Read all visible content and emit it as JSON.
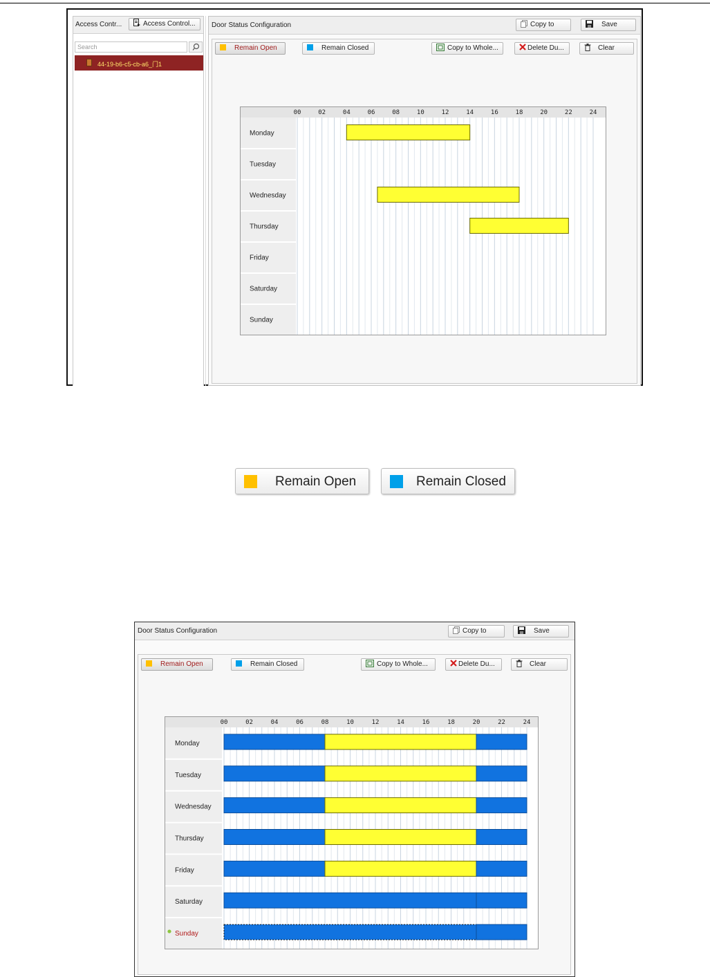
{
  "screen1": {
    "left_panel": {
      "title": "Access Contr...",
      "button": "Access Control...",
      "search_placeholder": "Search",
      "device": "44-19-b6-c5-cb-a6_门1"
    },
    "panel": {
      "title": "Door Status Configuration",
      "copy_to": "Copy to",
      "save": "Save",
      "remain_open": "Remain Open",
      "remain_closed": "Remain Closed",
      "copy_whole": "Copy to Whole...",
      "delete_duration": "Delete Du...",
      "clear": "Clear"
    },
    "schedule": {
      "hours": [
        "00",
        "02",
        "04",
        "06",
        "08",
        "10",
        "12",
        "14",
        "16",
        "18",
        "20",
        "22",
        "24"
      ],
      "days": [
        "Monday",
        "Tuesday",
        "Wednesday",
        "Thursday",
        "Friday",
        "Saturday",
        "Sunday"
      ],
      "segments": [
        {
          "day": 0,
          "start": 4,
          "end": 14,
          "mode": "open"
        },
        {
          "day": 2,
          "start": 6.5,
          "end": 18,
          "mode": "open"
        },
        {
          "day": 3,
          "start": 14,
          "end": 22,
          "mode": "open"
        }
      ]
    }
  },
  "legend": {
    "remain_open": "Remain Open",
    "remain_closed": "Remain Closed"
  },
  "screen2": {
    "panel": {
      "title": "Door Status Configuration",
      "copy_to": "Copy to",
      "save": "Save",
      "remain_open": "Remain Open",
      "remain_closed": "Remain Closed",
      "copy_whole": "Copy to Whole...",
      "delete_duration": "Delete Du...",
      "clear": "Clear"
    },
    "schedule": {
      "hours": [
        "00",
        "02",
        "04",
        "06",
        "08",
        "10",
        "12",
        "14",
        "16",
        "18",
        "20",
        "22",
        "24"
      ],
      "days": [
        "Monday",
        "Tuesday",
        "Wednesday",
        "Thursday",
        "Friday",
        "Saturday",
        "Sunday"
      ],
      "selected_day": 6,
      "segments": [
        {
          "day": 0,
          "start": 0,
          "end": 8,
          "mode": "closed"
        },
        {
          "day": 0,
          "start": 8,
          "end": 20,
          "mode": "open"
        },
        {
          "day": 0,
          "start": 20,
          "end": 24,
          "mode": "closed"
        },
        {
          "day": 1,
          "start": 0,
          "end": 8,
          "mode": "closed"
        },
        {
          "day": 1,
          "start": 8,
          "end": 20,
          "mode": "open"
        },
        {
          "day": 1,
          "start": 20,
          "end": 24,
          "mode": "closed"
        },
        {
          "day": 2,
          "start": 0,
          "end": 8,
          "mode": "closed"
        },
        {
          "day": 2,
          "start": 8,
          "end": 20,
          "mode": "open"
        },
        {
          "day": 2,
          "start": 20,
          "end": 24,
          "mode": "closed"
        },
        {
          "day": 3,
          "start": 0,
          "end": 8,
          "mode": "closed"
        },
        {
          "day": 3,
          "start": 8,
          "end": 20,
          "mode": "open"
        },
        {
          "day": 3,
          "start": 20,
          "end": 24,
          "mode": "closed"
        },
        {
          "day": 4,
          "start": 0,
          "end": 8,
          "mode": "closed"
        },
        {
          "day": 4,
          "start": 8,
          "end": 20,
          "mode": "open"
        },
        {
          "day": 4,
          "start": 20,
          "end": 24,
          "mode": "closed"
        },
        {
          "day": 5,
          "start": 0,
          "end": 20,
          "mode": "closed"
        },
        {
          "day": 5,
          "start": 20,
          "end": 24,
          "mode": "closed"
        },
        {
          "day": 6,
          "start": 0,
          "end": 20,
          "mode": "closed",
          "selected": true
        },
        {
          "day": 6,
          "start": 20,
          "end": 24,
          "mode": "closed"
        }
      ]
    }
  },
  "colors": {
    "open": "#ffff33",
    "closed": "#1173e0",
    "open_swatch": "#ffc000",
    "closed_swatch": "#00a0e9",
    "selected_text": "#b01a1a",
    "device_bg": "#8e2323"
  },
  "icons": [
    "search-icon",
    "access-control-icon",
    "door-icon",
    "copy-icon",
    "save-icon",
    "copy-whole-icon",
    "delete-icon",
    "clear-icon",
    "selected-dot-icon"
  ]
}
